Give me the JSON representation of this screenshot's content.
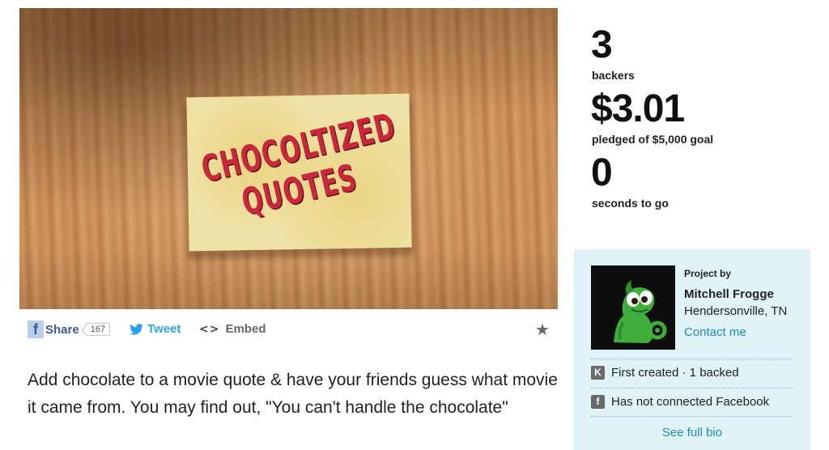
{
  "video": {
    "card_line1": "CHOCOLTIZED",
    "card_line2": "QUOTES"
  },
  "sharebar": {
    "facebook_icon": "facebook-icon",
    "share_label": "Share",
    "share_count": "167",
    "tweet_label": "Tweet",
    "embed_icon_text": "<>",
    "embed_label": "Embed",
    "star_icon": "star-icon"
  },
  "description": "Add chocolate to a movie quote & have your friends guess what movie it came from. You may find out, \"You can't handle the chocolate\"",
  "stats": {
    "backers_value": "3",
    "backers_label": "backers",
    "pledged_value": "$3.01",
    "pledged_label": "pledged of $5,000 goal",
    "time_value": "0",
    "time_label": "seconds to go"
  },
  "creator": {
    "project_by_label": "Project by",
    "name": "Mitchell Frogge",
    "location": "Hendersonville, TN",
    "contact_label": "Contact me",
    "first_created_icon": "K",
    "first_created_text": "First created · 1 backed",
    "facebook_icon": "f",
    "facebook_text": "Has not connected Facebook",
    "full_bio_label": "See full bio"
  },
  "colors": {
    "panel_bg": "#dff3f8",
    "link": "#1a8fb0",
    "twitter": "#2aa3ef",
    "facebook": "#3b5998"
  }
}
